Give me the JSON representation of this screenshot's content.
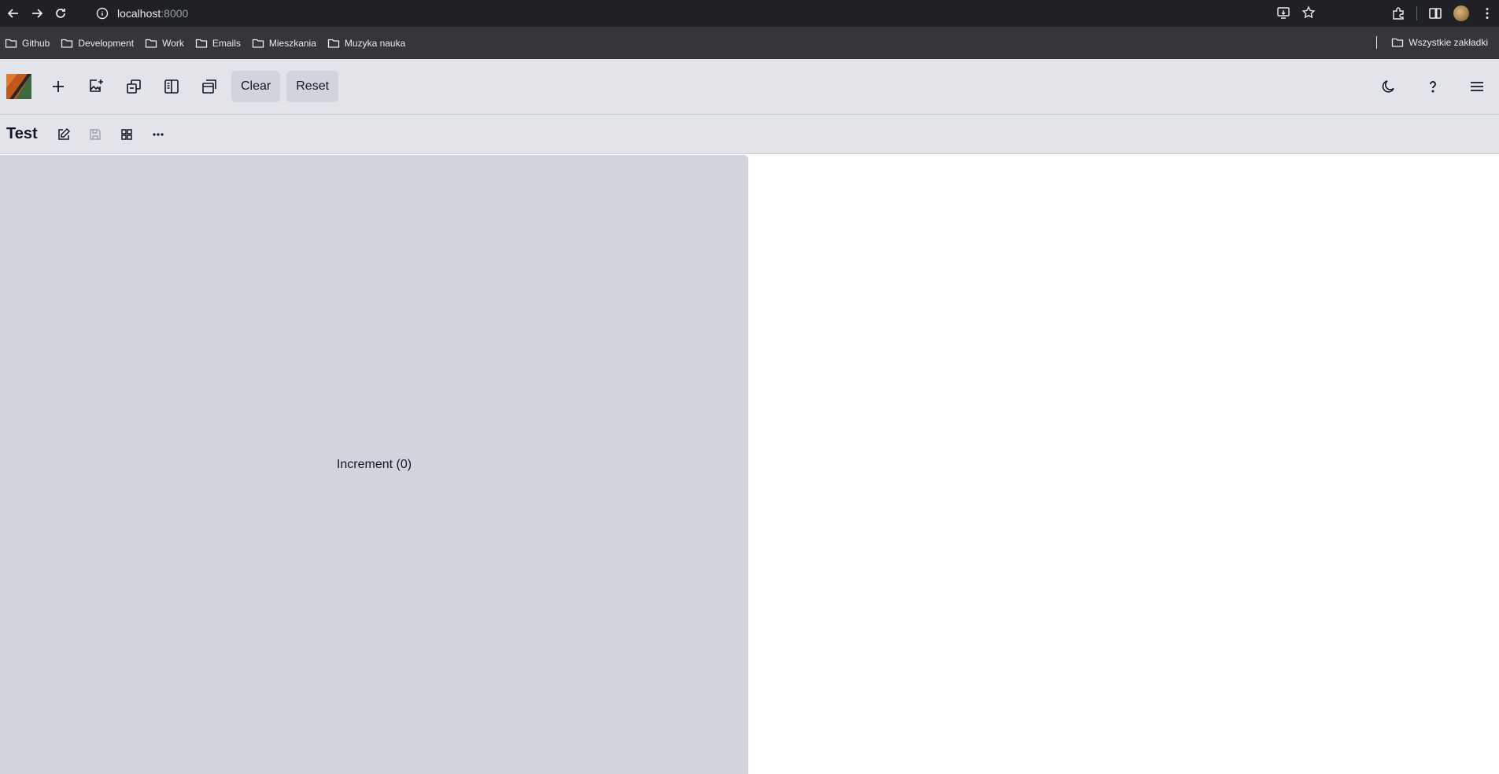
{
  "browser": {
    "url_host": "localhost",
    "url_port": ":8000",
    "bookmarks": [
      {
        "label": "Github"
      },
      {
        "label": "Development"
      },
      {
        "label": "Work"
      },
      {
        "label": "Emails"
      },
      {
        "label": "Mieszkania"
      },
      {
        "label": "Muzyka nauka"
      }
    ],
    "all_bookmarks_label": "Wszystkie zakładki"
  },
  "toolbar": {
    "clear_label": "Clear",
    "reset_label": "Reset"
  },
  "document": {
    "title": "Test"
  },
  "preview": {
    "increment_label": "Increment (0)"
  }
}
